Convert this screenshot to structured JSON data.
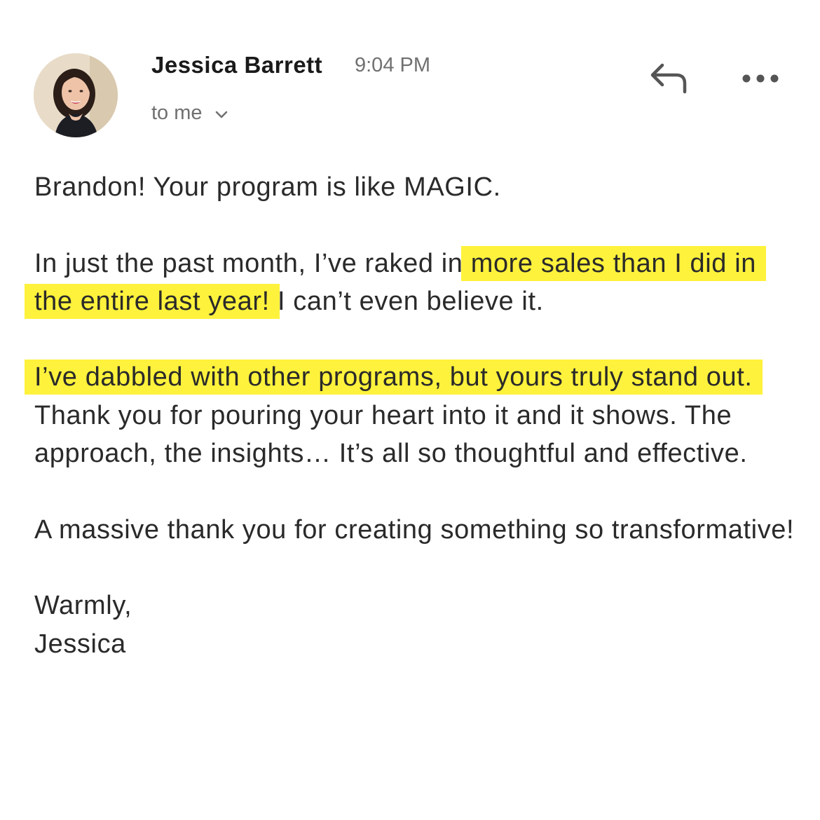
{
  "header": {
    "sender_name": "Jessica Barrett",
    "time": "9:04 PM",
    "recipient": "to me"
  },
  "icons": {
    "avatar": "avatar",
    "recipient_expand": "chevron-down-icon",
    "reply": "reply-icon",
    "more": "more-horizontal-icon"
  },
  "colors": {
    "highlight": "#fff23c",
    "text": "#2a2a2a",
    "muted": "#707070"
  },
  "message": {
    "greeting": "Brandon! Your program is like MAGIC.",
    "p2_before": "In just the past month, I’ve raked in ",
    "p2_highlight": "more sales than I did in the entire last year!",
    "p2_after": " I can’t even believe it.",
    "p3_highlight": "I’ve dabbled with other programs, but yours truly stand out.",
    "p3_after": " Thank you for pouring your heart into it and it shows. The approach, the insights… It’s all so thoughtful and effective.",
    "p4": "A massive thank you for creating something so transformative!",
    "signoff": "Warmly,",
    "signature": "Jessica"
  }
}
